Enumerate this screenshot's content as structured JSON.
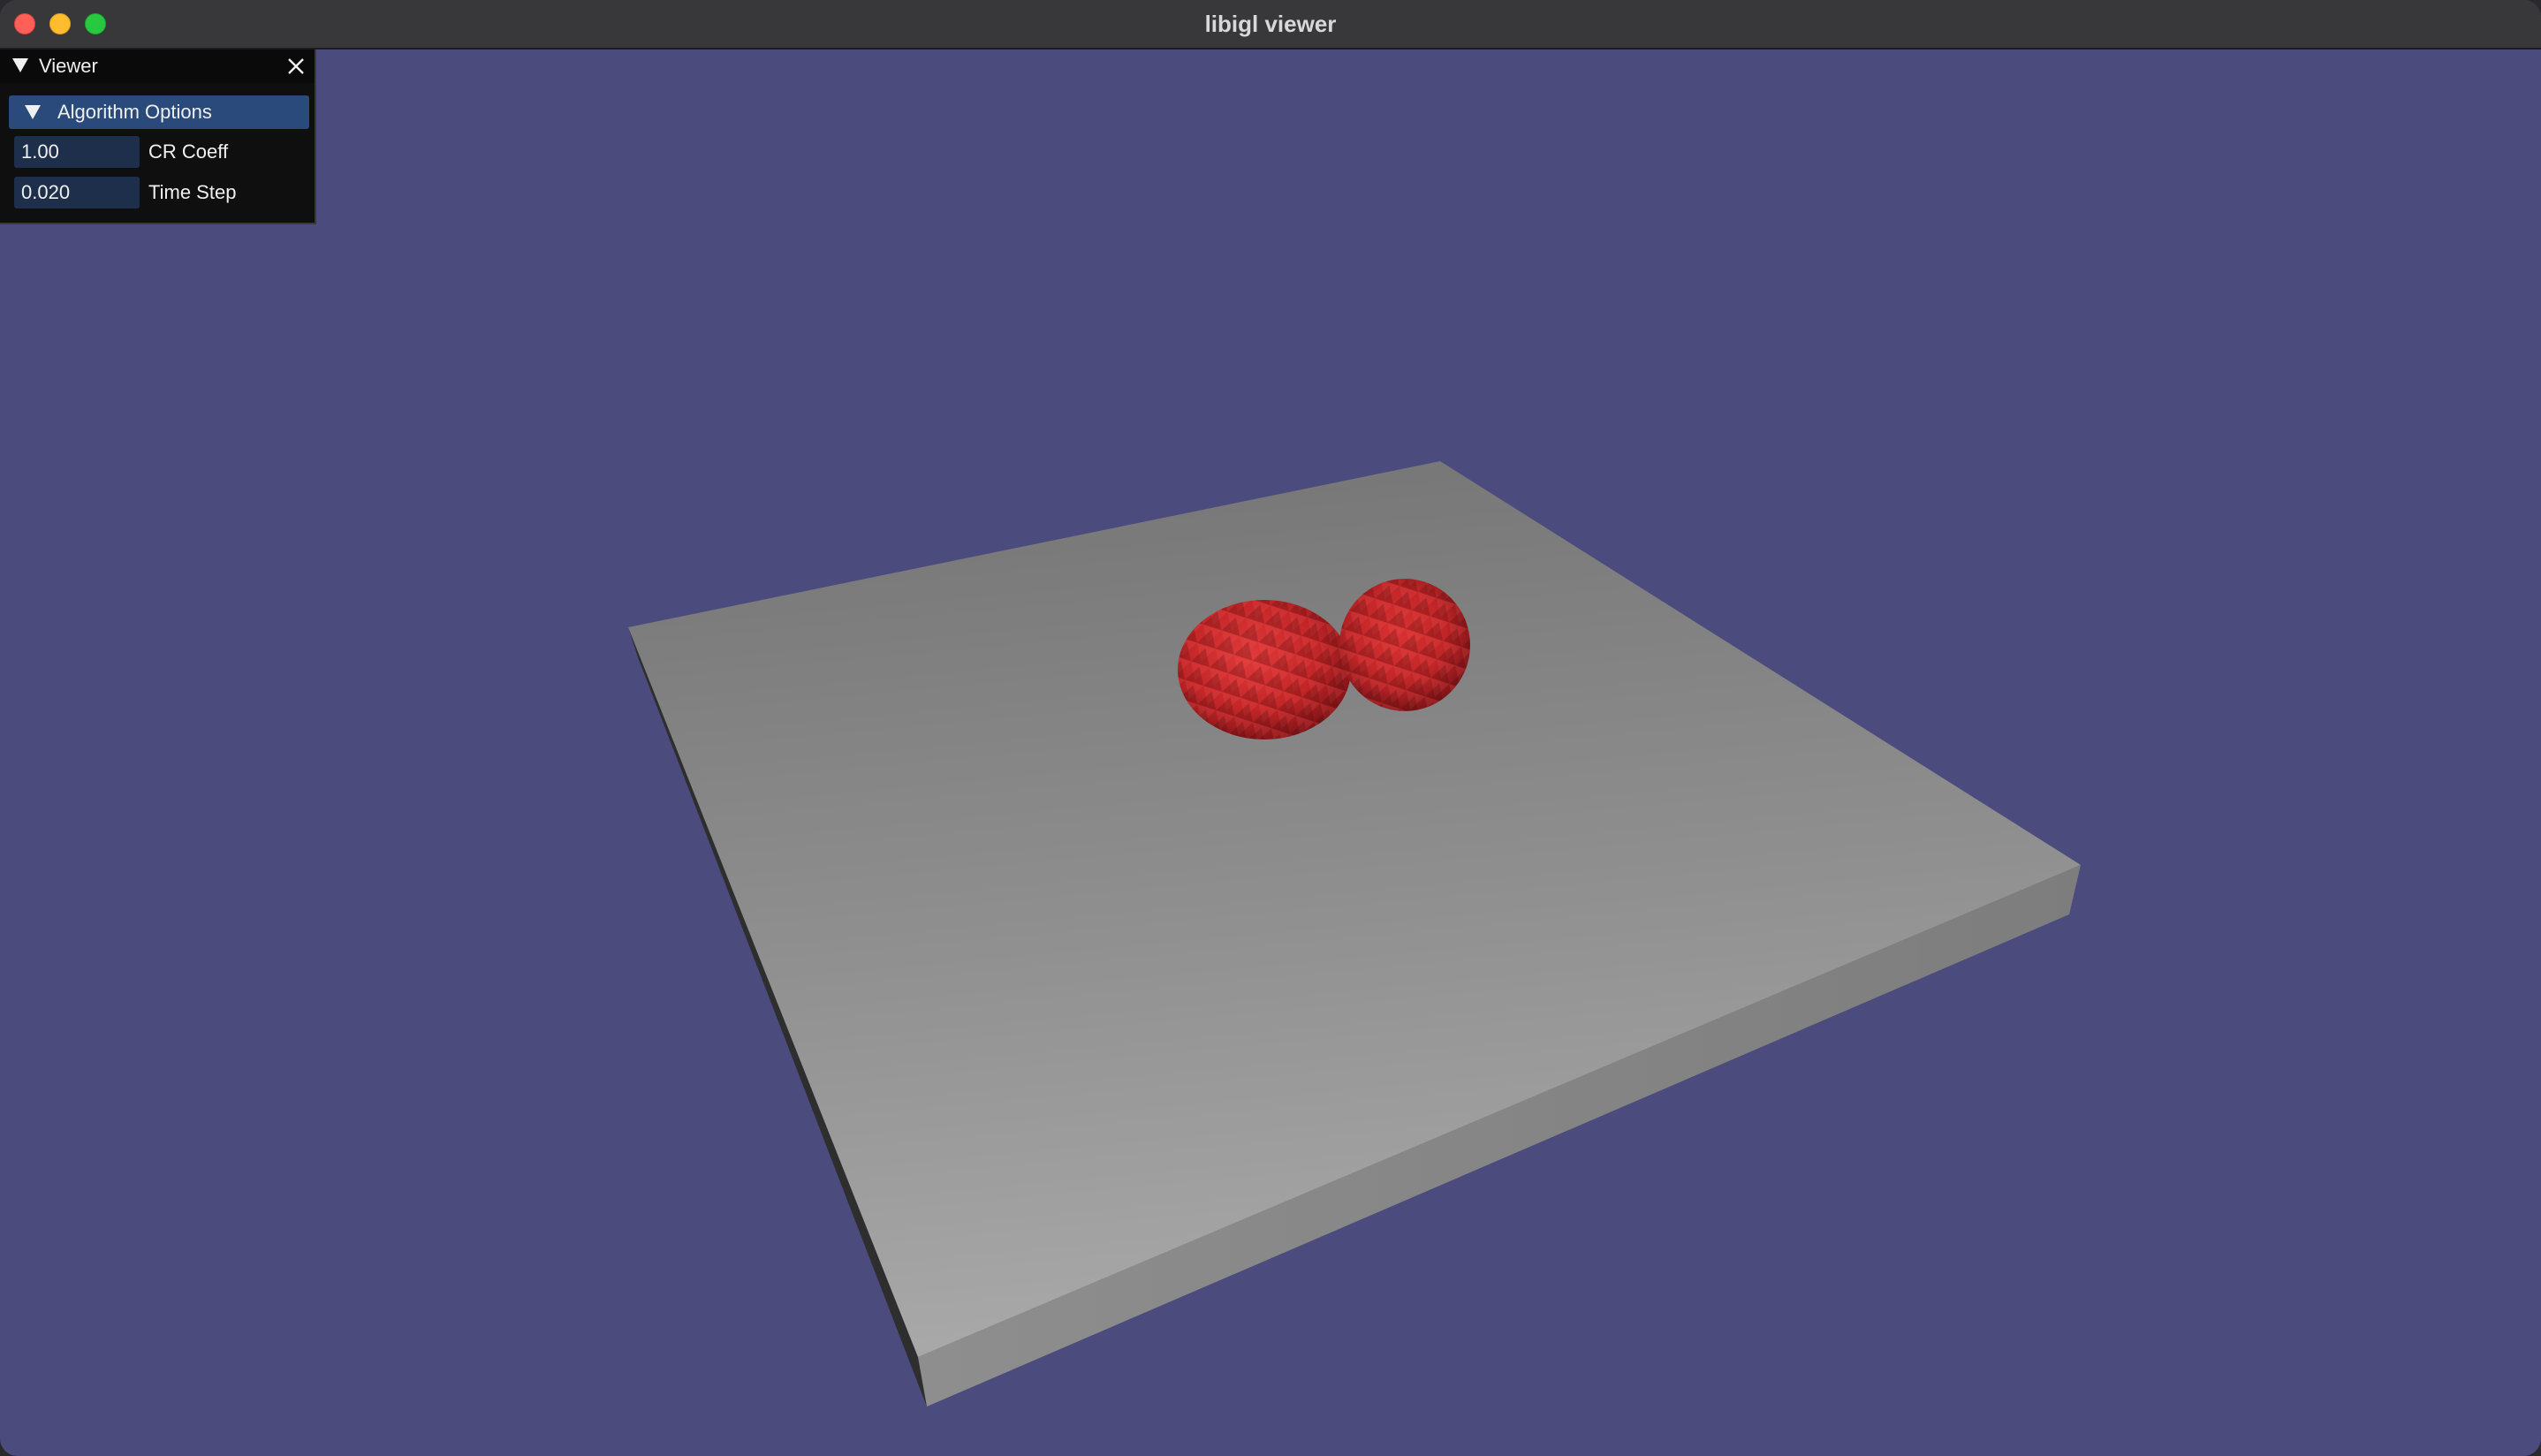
{
  "window": {
    "title": "libigl viewer"
  },
  "panel": {
    "title": "Viewer",
    "close_icon": "close-icon",
    "collapse_icon": "triangle-down-icon",
    "section": {
      "label": "Algorithm Options",
      "collapse_icon": "triangle-down-icon"
    },
    "fields": [
      {
        "value": "1.00",
        "label": "CR Coeff"
      },
      {
        "value": "0.020",
        "label": "Time Step"
      }
    ]
  },
  "scene": {
    "background_color": "#4c4b7d",
    "plate_color": "#9a9a9a",
    "sphere_color": "#c8252a"
  }
}
